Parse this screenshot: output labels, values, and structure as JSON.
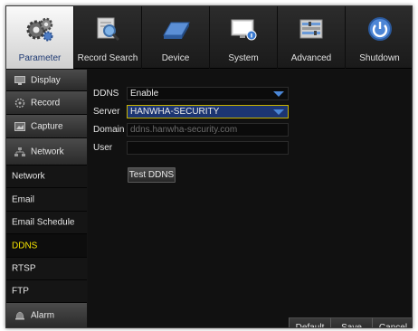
{
  "top_tabs": [
    {
      "label": "Parameter",
      "icon": "gears-icon",
      "active": true
    },
    {
      "label": "Record Search",
      "icon": "magnifier-icon",
      "active": false
    },
    {
      "label": "Device",
      "icon": "hard-drive-icon",
      "active": false
    },
    {
      "label": "System",
      "icon": "monitor-icon",
      "active": false
    },
    {
      "label": "Advanced",
      "icon": "advanced-settings-icon",
      "active": false
    },
    {
      "label": "Shutdown",
      "icon": "power-icon",
      "active": false
    }
  ],
  "sidebar": {
    "items": [
      {
        "label": "Display",
        "icon": "display-icon",
        "type": "category"
      },
      {
        "label": "Record",
        "icon": "record-icon",
        "type": "category"
      },
      {
        "label": "Capture",
        "icon": "capture-icon",
        "type": "category"
      },
      {
        "label": "Network",
        "icon": "network-icon",
        "type": "category"
      },
      {
        "label": "Network",
        "type": "sub"
      },
      {
        "label": "Email",
        "type": "sub"
      },
      {
        "label": "Email Schedule",
        "type": "sub"
      },
      {
        "label": "DDNS",
        "type": "sub",
        "active": true
      },
      {
        "label": "RTSP",
        "type": "sub"
      },
      {
        "label": "FTP",
        "type": "sub"
      },
      {
        "label": "Alarm",
        "icon": "alarm-icon",
        "type": "category"
      }
    ]
  },
  "form": {
    "ddns": {
      "label": "DDNS",
      "value": "Enable"
    },
    "server": {
      "label": "Server",
      "value": "HANWHA-SECURITY"
    },
    "domain": {
      "label": "Domain",
      "value": "ddns.hanwha-security.com"
    },
    "user": {
      "label": "User",
      "value": ""
    },
    "test_button": "Test DDNS"
  },
  "footer": {
    "default_label": "Default",
    "save_label": "Save",
    "cancel_label": "Cancel"
  },
  "colors": {
    "active_sidebar_text": "#f5e400",
    "selected_field_bg": "#1c3572",
    "selected_field_border": "#c9b400"
  }
}
